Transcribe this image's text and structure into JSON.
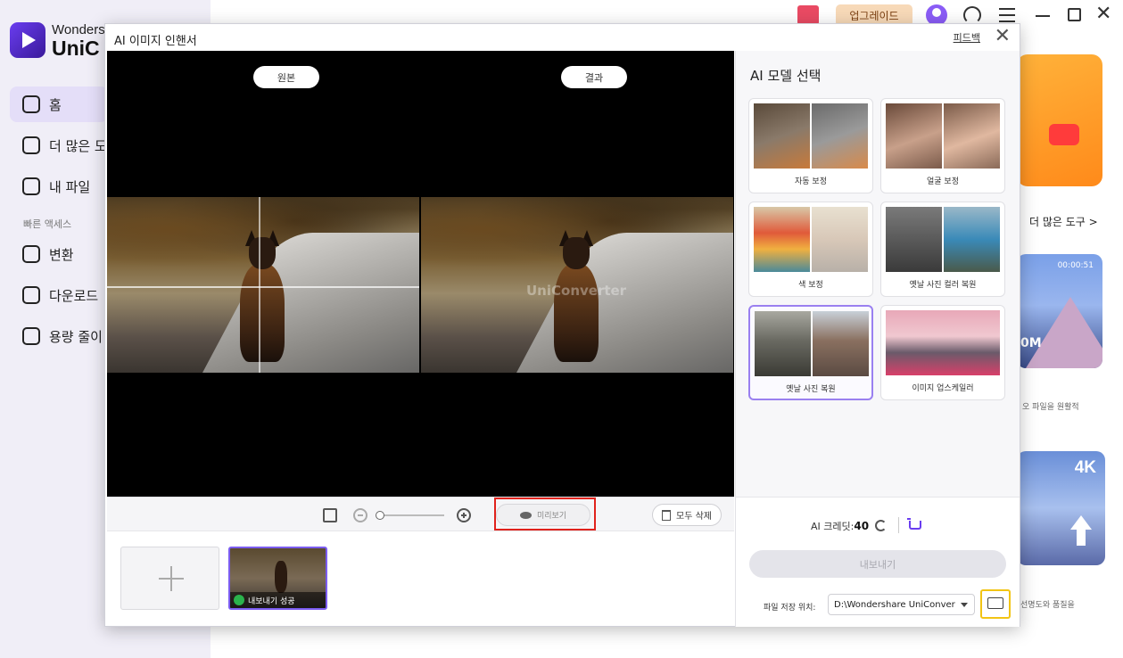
{
  "app": {
    "brand_line1": "Wonders",
    "brand_line2": "UniC",
    "nav": [
      {
        "label": "홈",
        "active": true
      },
      {
        "label": "더 많은 도"
      },
      {
        "label": "내 파일"
      }
    ],
    "quick_access_label": "빠른 액세스",
    "quick": [
      {
        "label": "변환"
      },
      {
        "label": "다운로드"
      },
      {
        "label": "용량 줄이"
      }
    ],
    "upgrade_label": "업그레이드",
    "more_tools_label": "더 많은 도구 >",
    "card_mtn_time": "00:00:51",
    "card_mtn_badge": "0M",
    "card_mtn_caption": "오 파일을 원활적",
    "card_4k_label": "4K",
    "card_4k_caption": "선명도와 품질을"
  },
  "dialog": {
    "title": "AI 이미지 인핸서",
    "feedback_label": "피드백",
    "original_label": "원본",
    "result_label": "결과",
    "watermark": "UniConverter",
    "preview_label": "미리보기",
    "delete_all_label": "모두 삭제",
    "thumb_status": "내보내기 성공",
    "panel_title": "AI 모델 선택",
    "models": [
      {
        "label": "자동 보정"
      },
      {
        "label": "얼굴 보정"
      },
      {
        "label": "색 보정"
      },
      {
        "label": "옛날 사진 컬러 복원"
      },
      {
        "label": "옛날 사진 복원",
        "selected": true
      },
      {
        "label": "이미지 업스케일러"
      }
    ],
    "credits_label": "AI 크레딧:",
    "credits_value": "40",
    "export_label": "내보내기",
    "path_label": "파일 저장 위치:",
    "path_value": "D:\\Wondershare UniConver"
  },
  "colors": {
    "accent": "#7b5cf0",
    "highlight_red": "#e0221c",
    "highlight_yellow": "#f2c414"
  }
}
